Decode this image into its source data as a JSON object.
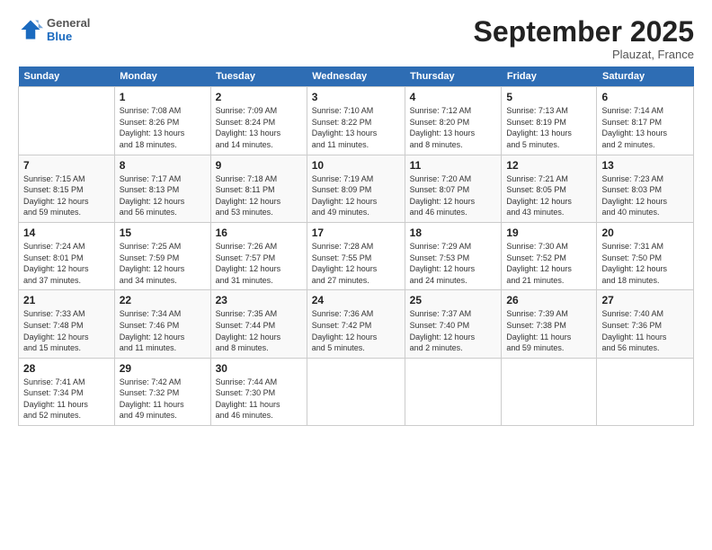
{
  "header": {
    "logo_general": "General",
    "logo_blue": "Blue",
    "title": "September 2025",
    "subtitle": "Plauzat, France"
  },
  "days": [
    "Sunday",
    "Monday",
    "Tuesday",
    "Wednesday",
    "Thursday",
    "Friday",
    "Saturday"
  ],
  "weeks": [
    [
      {
        "date": "",
        "info": ""
      },
      {
        "date": "1",
        "info": "Sunrise: 7:08 AM\nSunset: 8:26 PM\nDaylight: 13 hours\nand 18 minutes."
      },
      {
        "date": "2",
        "info": "Sunrise: 7:09 AM\nSunset: 8:24 PM\nDaylight: 13 hours\nand 14 minutes."
      },
      {
        "date": "3",
        "info": "Sunrise: 7:10 AM\nSunset: 8:22 PM\nDaylight: 13 hours\nand 11 minutes."
      },
      {
        "date": "4",
        "info": "Sunrise: 7:12 AM\nSunset: 8:20 PM\nDaylight: 13 hours\nand 8 minutes."
      },
      {
        "date": "5",
        "info": "Sunrise: 7:13 AM\nSunset: 8:19 PM\nDaylight: 13 hours\nand 5 minutes."
      },
      {
        "date": "6",
        "info": "Sunrise: 7:14 AM\nSunset: 8:17 PM\nDaylight: 13 hours\nand 2 minutes."
      }
    ],
    [
      {
        "date": "7",
        "info": "Sunrise: 7:15 AM\nSunset: 8:15 PM\nDaylight: 12 hours\nand 59 minutes."
      },
      {
        "date": "8",
        "info": "Sunrise: 7:17 AM\nSunset: 8:13 PM\nDaylight: 12 hours\nand 56 minutes."
      },
      {
        "date": "9",
        "info": "Sunrise: 7:18 AM\nSunset: 8:11 PM\nDaylight: 12 hours\nand 53 minutes."
      },
      {
        "date": "10",
        "info": "Sunrise: 7:19 AM\nSunset: 8:09 PM\nDaylight: 12 hours\nand 49 minutes."
      },
      {
        "date": "11",
        "info": "Sunrise: 7:20 AM\nSunset: 8:07 PM\nDaylight: 12 hours\nand 46 minutes."
      },
      {
        "date": "12",
        "info": "Sunrise: 7:21 AM\nSunset: 8:05 PM\nDaylight: 12 hours\nand 43 minutes."
      },
      {
        "date": "13",
        "info": "Sunrise: 7:23 AM\nSunset: 8:03 PM\nDaylight: 12 hours\nand 40 minutes."
      }
    ],
    [
      {
        "date": "14",
        "info": "Sunrise: 7:24 AM\nSunset: 8:01 PM\nDaylight: 12 hours\nand 37 minutes."
      },
      {
        "date": "15",
        "info": "Sunrise: 7:25 AM\nSunset: 7:59 PM\nDaylight: 12 hours\nand 34 minutes."
      },
      {
        "date": "16",
        "info": "Sunrise: 7:26 AM\nSunset: 7:57 PM\nDaylight: 12 hours\nand 31 minutes."
      },
      {
        "date": "17",
        "info": "Sunrise: 7:28 AM\nSunset: 7:55 PM\nDaylight: 12 hours\nand 27 minutes."
      },
      {
        "date": "18",
        "info": "Sunrise: 7:29 AM\nSunset: 7:53 PM\nDaylight: 12 hours\nand 24 minutes."
      },
      {
        "date": "19",
        "info": "Sunrise: 7:30 AM\nSunset: 7:52 PM\nDaylight: 12 hours\nand 21 minutes."
      },
      {
        "date": "20",
        "info": "Sunrise: 7:31 AM\nSunset: 7:50 PM\nDaylight: 12 hours\nand 18 minutes."
      }
    ],
    [
      {
        "date": "21",
        "info": "Sunrise: 7:33 AM\nSunset: 7:48 PM\nDaylight: 12 hours\nand 15 minutes."
      },
      {
        "date": "22",
        "info": "Sunrise: 7:34 AM\nSunset: 7:46 PM\nDaylight: 12 hours\nand 11 minutes."
      },
      {
        "date": "23",
        "info": "Sunrise: 7:35 AM\nSunset: 7:44 PM\nDaylight: 12 hours\nand 8 minutes."
      },
      {
        "date": "24",
        "info": "Sunrise: 7:36 AM\nSunset: 7:42 PM\nDaylight: 12 hours\nand 5 minutes."
      },
      {
        "date": "25",
        "info": "Sunrise: 7:37 AM\nSunset: 7:40 PM\nDaylight: 12 hours\nand 2 minutes."
      },
      {
        "date": "26",
        "info": "Sunrise: 7:39 AM\nSunset: 7:38 PM\nDaylight: 11 hours\nand 59 minutes."
      },
      {
        "date": "27",
        "info": "Sunrise: 7:40 AM\nSunset: 7:36 PM\nDaylight: 11 hours\nand 56 minutes."
      }
    ],
    [
      {
        "date": "28",
        "info": "Sunrise: 7:41 AM\nSunset: 7:34 PM\nDaylight: 11 hours\nand 52 minutes."
      },
      {
        "date": "29",
        "info": "Sunrise: 7:42 AM\nSunset: 7:32 PM\nDaylight: 11 hours\nand 49 minutes."
      },
      {
        "date": "30",
        "info": "Sunrise: 7:44 AM\nSunset: 7:30 PM\nDaylight: 11 hours\nand 46 minutes."
      },
      {
        "date": "",
        "info": ""
      },
      {
        "date": "",
        "info": ""
      },
      {
        "date": "",
        "info": ""
      },
      {
        "date": "",
        "info": ""
      }
    ]
  ]
}
